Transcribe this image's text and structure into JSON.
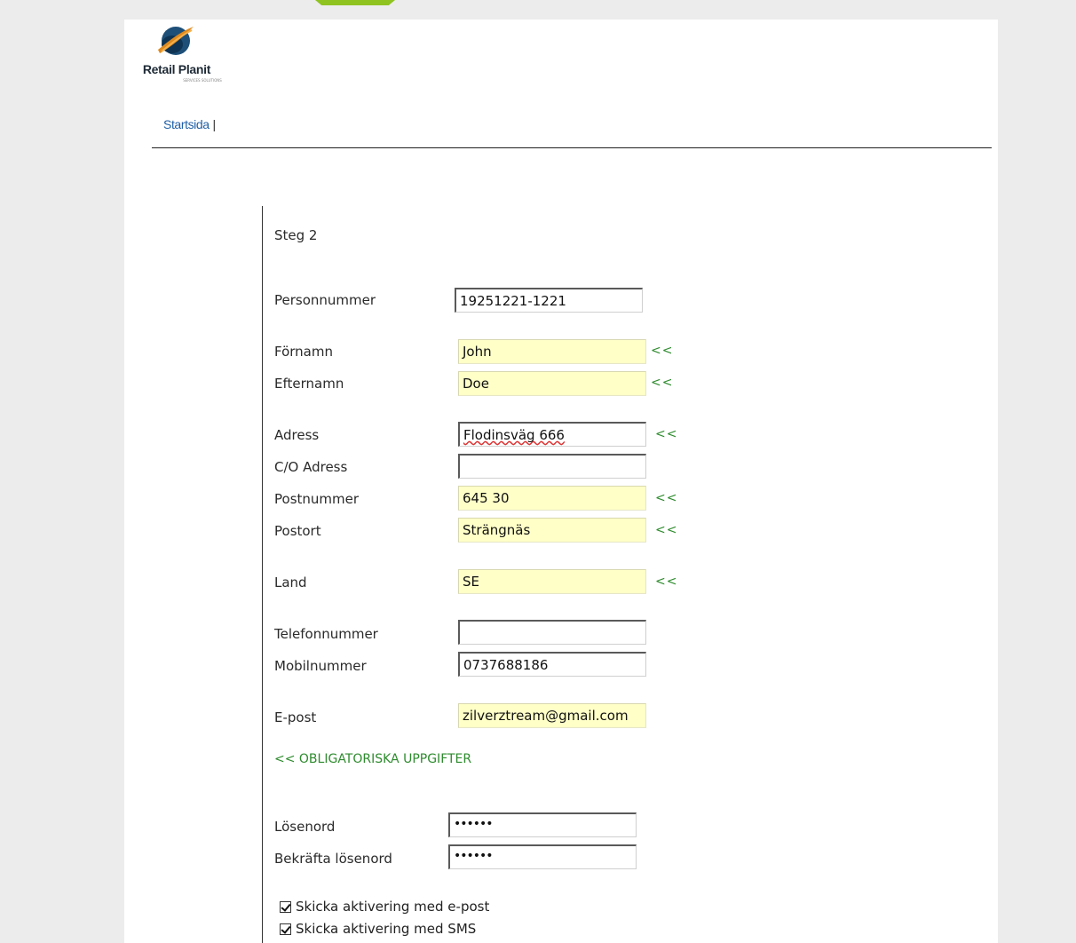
{
  "brand": {
    "name": "Retail Planit",
    "tagline": "SERVICES SOLUTIONS"
  },
  "colors": {
    "required": "#2e8b2e",
    "filled_bg": "#ffffc8",
    "link": "#1f5fa6"
  },
  "nav": {
    "home_label": "Startsida",
    "separator": "|"
  },
  "form": {
    "step_title": "Steg 2",
    "required_marker": "<<",
    "required_note": "<< OBLIGATORISKA UPPGIFTER",
    "fields": {
      "personnummer": {
        "label": "Personnummer",
        "value": "19251221-1221"
      },
      "fornamn": {
        "label": "Förnamn",
        "value": "John"
      },
      "efternamn": {
        "label": "Efternamn",
        "value": "Doe"
      },
      "adress": {
        "label": "Adress",
        "value": "Flodinsväg 666"
      },
      "co_adress": {
        "label": "C/O Adress",
        "value": ""
      },
      "postnummer": {
        "label": "Postnummer",
        "value": "645 30"
      },
      "postort": {
        "label": "Postort",
        "value": "Strängnäs"
      },
      "land": {
        "label": "Land",
        "value": "SE"
      },
      "telefon": {
        "label": "Telefonnummer",
        "value": ""
      },
      "mobil": {
        "label": "Mobilnummer",
        "value": "0737688186"
      },
      "epost": {
        "label": "E-post",
        "value": "zilverztream@gmail.com"
      },
      "losenord": {
        "label": "Lösenord",
        "value": "••••••"
      },
      "bekrafta": {
        "label": "Bekräfta lösenord",
        "value": "••••••"
      }
    },
    "checkboxes": {
      "email_activation": {
        "label": "Skicka aktivering med e-post",
        "checked": true
      },
      "sms_activation": {
        "label": "Skicka aktivering med SMS",
        "checked": true
      }
    }
  }
}
